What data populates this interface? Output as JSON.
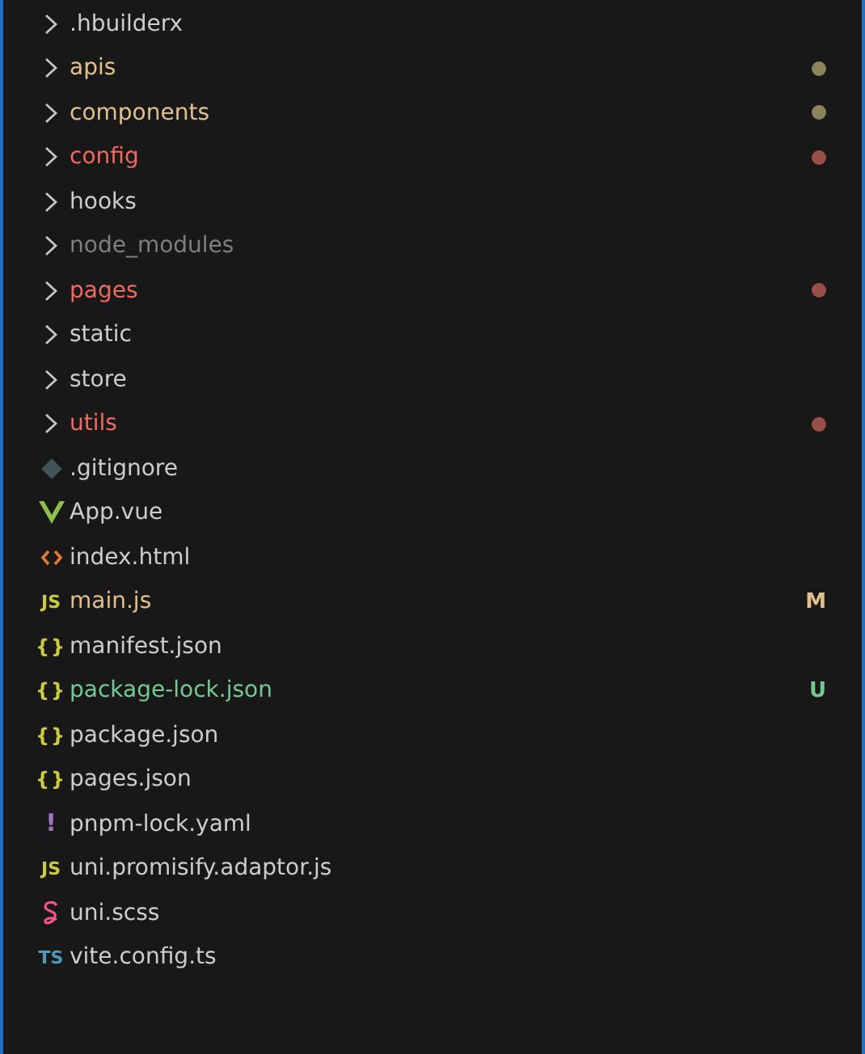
{
  "explorer": {
    "items": [
      {
        "kind": "folder",
        "name": ".hbuilderx",
        "color": "#cccccc"
      },
      {
        "kind": "folder",
        "name": "apis",
        "color": "#e2c08d",
        "dot": {
          "color": "#8a8458"
        }
      },
      {
        "kind": "folder",
        "name": "components",
        "color": "#e2c08d",
        "dot": {
          "color": "#8a8458"
        }
      },
      {
        "kind": "folder",
        "name": "config",
        "color": "#f0695f",
        "dot": {
          "color": "#9a4e48"
        }
      },
      {
        "kind": "folder",
        "name": "hooks",
        "color": "#cccccc"
      },
      {
        "kind": "folder",
        "name": "node_modules",
        "color": "#7e7e7e"
      },
      {
        "kind": "folder",
        "name": "pages",
        "color": "#f0695f",
        "dot": {
          "color": "#9a4e48"
        }
      },
      {
        "kind": "folder",
        "name": "static",
        "color": "#cccccc"
      },
      {
        "kind": "folder",
        "name": "store",
        "color": "#cccccc"
      },
      {
        "kind": "folder",
        "name": "utils",
        "color": "#f0695f",
        "dot": {
          "color": "#9a4e48"
        }
      },
      {
        "kind": "git",
        "name": ".gitignore",
        "color": "#cccccc"
      },
      {
        "kind": "vue",
        "name": "App.vue",
        "color": "#cccccc"
      },
      {
        "kind": "html",
        "name": "index.html",
        "color": "#cccccc"
      },
      {
        "kind": "js",
        "icon_text": "JS",
        "name": "main.js",
        "color": "#e2c08d",
        "badge": "M"
      },
      {
        "kind": "json",
        "icon_text": "{}",
        "name": "manifest.json",
        "color": "#cccccc"
      },
      {
        "kind": "json",
        "icon_text": "{}",
        "name": "package-lock.json",
        "color": "#73c991",
        "badge": "U"
      },
      {
        "kind": "json",
        "icon_text": "{}",
        "name": "package.json",
        "color": "#cccccc"
      },
      {
        "kind": "json",
        "icon_text": "{}",
        "name": "pages.json",
        "color": "#cccccc"
      },
      {
        "kind": "yaml",
        "icon_text": "!",
        "name": "pnpm-lock.yaml",
        "color": "#cccccc"
      },
      {
        "kind": "js",
        "icon_text": "JS",
        "name": "uni.promisify.adaptor.js",
        "color": "#cccccc"
      },
      {
        "kind": "sass",
        "name": "uni.scss",
        "color": "#cccccc"
      },
      {
        "kind": "ts",
        "icon_text": "TS",
        "name": "vite.config.ts",
        "color": "#cccccc"
      }
    ]
  }
}
